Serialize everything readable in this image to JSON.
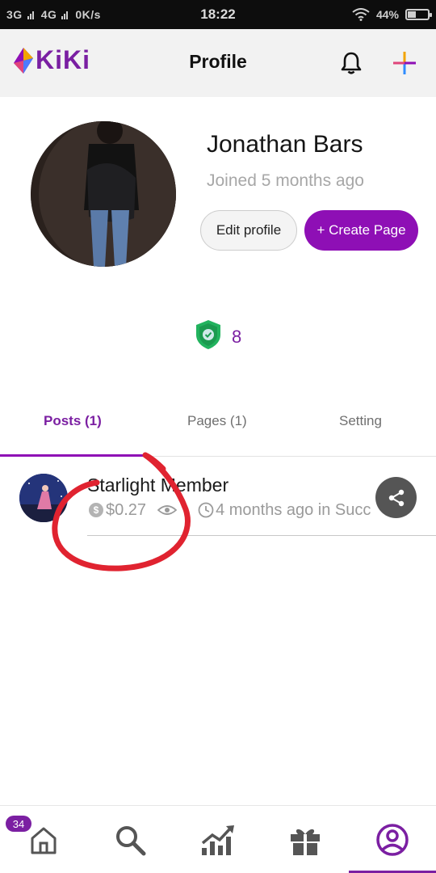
{
  "status_bar": {
    "network": "3G",
    "network2": "4G",
    "speed": "0K/s",
    "time": "18:22",
    "battery": "44%"
  },
  "app_bar": {
    "logo_text": "KiKi",
    "title": "Profile"
  },
  "profile": {
    "name": "Jonathan Bars",
    "joined": "Joined 5 months ago",
    "edit_button": "Edit profile",
    "create_button": "+ Create Page",
    "score": "8"
  },
  "tabs": [
    {
      "label": "Posts (1)",
      "active": true
    },
    {
      "label": "Pages (1)",
      "active": false
    },
    {
      "label": "Setting",
      "active": false
    }
  ],
  "posts": [
    {
      "title": "Starlight Member",
      "earnings": "$0.27",
      "time": "4 months ago in Succ"
    }
  ],
  "bottom_nav": {
    "badge": "34",
    "items": [
      "home-icon",
      "search-icon",
      "trending-icon",
      "gift-icon",
      "profile-icon"
    ],
    "active": "profile-icon"
  },
  "colors": {
    "brand_purple": "#8e0fb5",
    "annotation_red": "#e02330",
    "shield_green": "#22b35e"
  }
}
